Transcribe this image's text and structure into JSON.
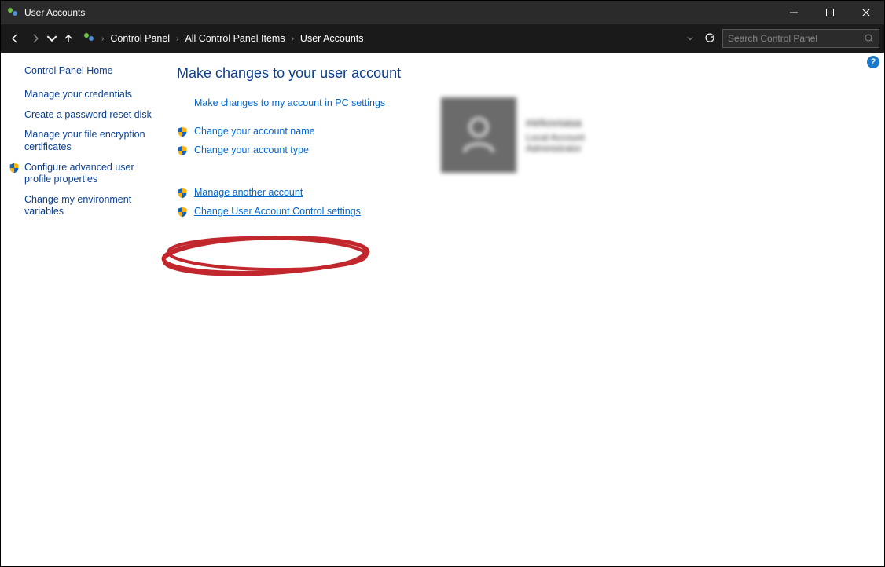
{
  "window": {
    "title": "User Accounts",
    "search_placeholder": "Search Control Panel"
  },
  "breadcrumbs": {
    "item1": "Control Panel",
    "item2": "All Control Panel Items",
    "item3": "User Accounts"
  },
  "sidebar": {
    "home": "Control Panel Home",
    "items": [
      "Manage your credentials",
      "Create a password reset disk",
      "Manage your file encryption certificates",
      "Configure advanced user profile properties",
      "Change my environment variables"
    ]
  },
  "main": {
    "heading": "Make changes to your user account",
    "link_pc_settings": "Make changes to my account in PC settings",
    "link_change_name": "Change your account name",
    "link_change_type": "Change your account type",
    "link_manage_another": "Manage another account",
    "link_uac_settings": "Change User Account Control settings"
  },
  "user": {
    "name": "mirkovsasa",
    "type": "Local Account",
    "role": "Administrator"
  },
  "icons": {
    "shield": "shield-icon",
    "help": "?"
  }
}
